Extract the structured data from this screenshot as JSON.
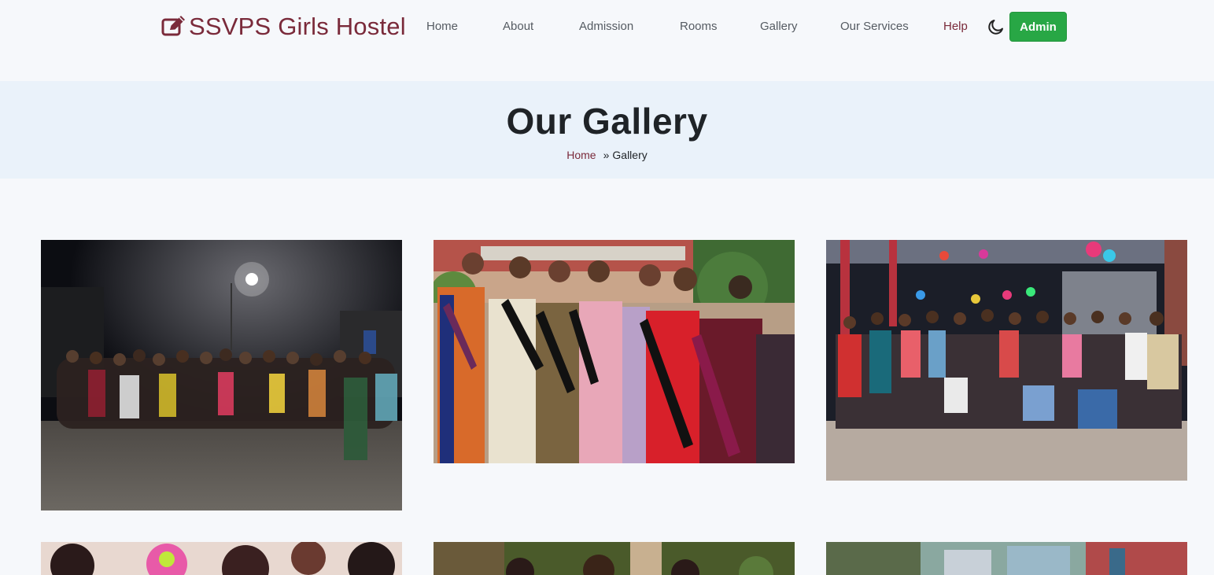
{
  "brand": {
    "title": "SSVPS Girls Hostel",
    "color": "#7a2a3a"
  },
  "nav": {
    "home": "Home",
    "about": "About",
    "admission": "Admission",
    "rooms": "Rooms",
    "gallery": "Gallery",
    "services": "Our Services",
    "help": "Help"
  },
  "theme_toggle_icon": "moon-icon",
  "admin_button": {
    "label": "Admin",
    "color": "#28a745"
  },
  "header": {
    "title": "Our Gallery",
    "breadcrumb": {
      "home": "Home",
      "separator": "»",
      "current": "Gallery"
    }
  },
  "gallery": {
    "images": [
      {
        "name": "night-street-group-photo"
      },
      {
        "name": "pageant-winners-sashes-photo"
      },
      {
        "name": "decorated-terrace-party-photo"
      },
      {
        "name": "holi-celebration-photo"
      },
      {
        "name": "garden-group-photo"
      },
      {
        "name": "campus-street-photo"
      }
    ]
  }
}
